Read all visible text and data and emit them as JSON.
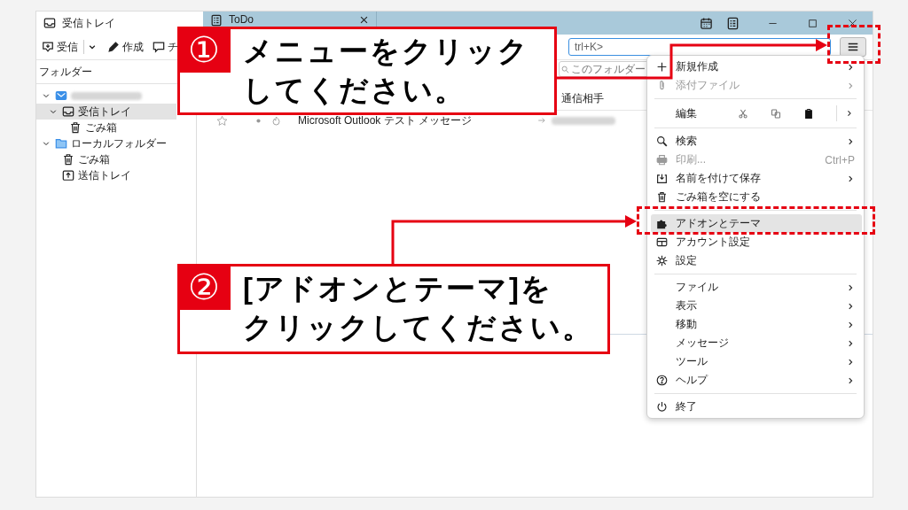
{
  "window": {
    "tabs": [
      {
        "label": "受信トレイ",
        "kind": "inbox",
        "selected": true
      },
      {
        "label": "ToDo",
        "kind": "tasks",
        "selected": false
      }
    ]
  },
  "toolbar": {
    "buttons": [
      {
        "kind": "get",
        "label": "受信"
      },
      {
        "kind": "compose",
        "label": "作成"
      },
      {
        "kind": "chat",
        "label": "チ"
      }
    ],
    "search_placeholder": "trl+K>"
  },
  "folder_pane": {
    "header": "フォルダー",
    "folders": [
      {
        "kind": "mail",
        "expanded": true,
        "selected": false,
        "children": [
          {
            "kind": "inbox",
            "label": "受信トレイ",
            "expanded": true,
            "selected": true,
            "children": [
              {
                "kind": "trash",
                "label": "ごみ箱",
                "selected": false
              }
            ]
          }
        ]
      },
      {
        "kind": "folder",
        "label": "ローカルフォルダー",
        "expanded": true,
        "selected": false,
        "children": [
          {
            "kind": "trash",
            "label": "ごみ箱",
            "selected": false
          },
          {
            "kind": "outbox",
            "label": "送信トレイ",
            "selected": false
          }
        ]
      }
    ]
  },
  "message_list": {
    "search_placeholder": "このフォルダー",
    "columns": [
      "通信相手"
    ],
    "messages": [
      {
        "subject": "Microsoft Outlook テスト メッセージ",
        "starred": false
      }
    ]
  },
  "menu": {
    "items": [
      {
        "kind": "plus",
        "label": "新規作成",
        "submenu": true,
        "disabled": false,
        "selected": false
      },
      {
        "kind": "paperclip",
        "label": "添付ファイル",
        "submenu": true,
        "disabled": true,
        "selected": false
      },
      {
        "kind": "separator"
      },
      {
        "kind": "edit",
        "label": "編集"
      },
      {
        "kind": "separator"
      },
      {
        "kind": "search",
        "label": "検索",
        "submenu": true,
        "disabled": false,
        "selected": false
      },
      {
        "kind": "printer",
        "label": "印刷...",
        "shortcut": "Ctrl+P",
        "submenu": false,
        "disabled": true,
        "selected": false
      },
      {
        "kind": "save",
        "label": "名前を付けて保存",
        "submenu": true,
        "disabled": false,
        "selected": false
      },
      {
        "kind": "trash",
        "label": "ごみ箱を空にする",
        "submenu": false,
        "disabled": false,
        "selected": false
      },
      {
        "kind": "separator"
      },
      {
        "kind": "puzzle",
        "label": "アドオンとテーマ",
        "submenu": false,
        "disabled": false,
        "selected": true
      },
      {
        "kind": "account",
        "label": "アカウント設定",
        "submenu": false,
        "disabled": false,
        "selected": false
      },
      {
        "kind": "gear",
        "label": "設定",
        "submenu": false,
        "disabled": false,
        "selected": false
      },
      {
        "kind": "separator"
      },
      {
        "kind": "plain",
        "label": "ファイル",
        "submenu": true,
        "disabled": false,
        "selected": false
      },
      {
        "kind": "plain",
        "label": "表示",
        "submenu": true,
        "disabled": false,
        "selected": false
      },
      {
        "kind": "plain",
        "label": "移動",
        "submenu": true,
        "disabled": false,
        "selected": false
      },
      {
        "kind": "plain",
        "label": "メッセージ",
        "submenu": true,
        "disabled": false,
        "selected": false
      },
      {
        "kind": "plain",
        "label": "ツール",
        "submenu": true,
        "disabled": false,
        "selected": false
      },
      {
        "kind": "help",
        "label": "ヘルプ",
        "submenu": true,
        "disabled": false,
        "selected": false
      },
      {
        "kind": "separator"
      },
      {
        "kind": "power",
        "label": "終了",
        "submenu": false,
        "disabled": false,
        "selected": false
      }
    ]
  },
  "callouts": [
    {
      "number": "①",
      "lines": [
        "メニューをクリック",
        "してください。"
      ]
    },
    {
      "number": "②",
      "lines": [
        "[アドオンとテーマ]を",
        "クリックしてください。"
      ]
    }
  ]
}
